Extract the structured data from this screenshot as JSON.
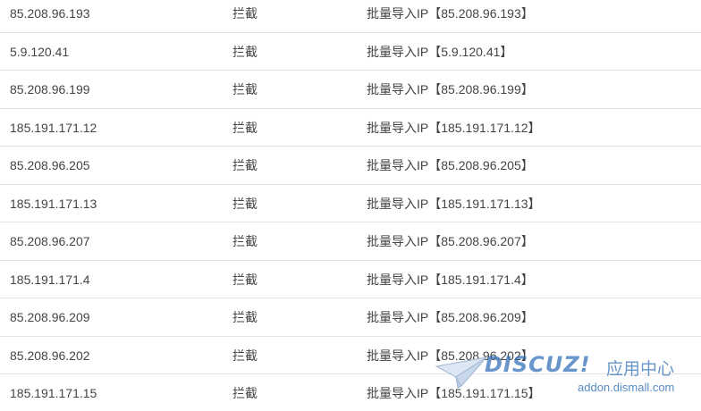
{
  "rows": [
    {
      "ip": "85.208.96.193",
      "action": "拦截",
      "remark": "批量导入IP【85.208.96.193】"
    },
    {
      "ip": "5.9.120.41",
      "action": "拦截",
      "remark": "批量导入IP【5.9.120.41】"
    },
    {
      "ip": "85.208.96.199",
      "action": "拦截",
      "remark": "批量导入IP【85.208.96.199】"
    },
    {
      "ip": "185.191.171.12",
      "action": "拦截",
      "remark": "批量导入IP【185.191.171.12】"
    },
    {
      "ip": "85.208.96.205",
      "action": "拦截",
      "remark": "批量导入IP【85.208.96.205】"
    },
    {
      "ip": "185.191.171.13",
      "action": "拦截",
      "remark": "批量导入IP【185.191.171.13】"
    },
    {
      "ip": "85.208.96.207",
      "action": "拦截",
      "remark": "批量导入IP【85.208.96.207】"
    },
    {
      "ip": "185.191.171.4",
      "action": "拦截",
      "remark": "批量导入IP【185.191.171.4】"
    },
    {
      "ip": "85.208.96.209",
      "action": "拦截",
      "remark": "批量导入IP【85.208.96.209】"
    },
    {
      "ip": "85.208.96.202",
      "action": "拦截",
      "remark": "批量导入IP【85.208.96.202】"
    },
    {
      "ip": "185.191.171.15",
      "action": "拦截",
      "remark": "批量导入IP【185.191.171.15】"
    }
  ],
  "watermark": {
    "brand": "DISCUZ!",
    "brand_cn": "应用中心",
    "url": "addon.dismall.com",
    "color": "#2f6fb7"
  },
  "colors": {
    "text": "#444444",
    "row_border": "#e4e4e4"
  }
}
